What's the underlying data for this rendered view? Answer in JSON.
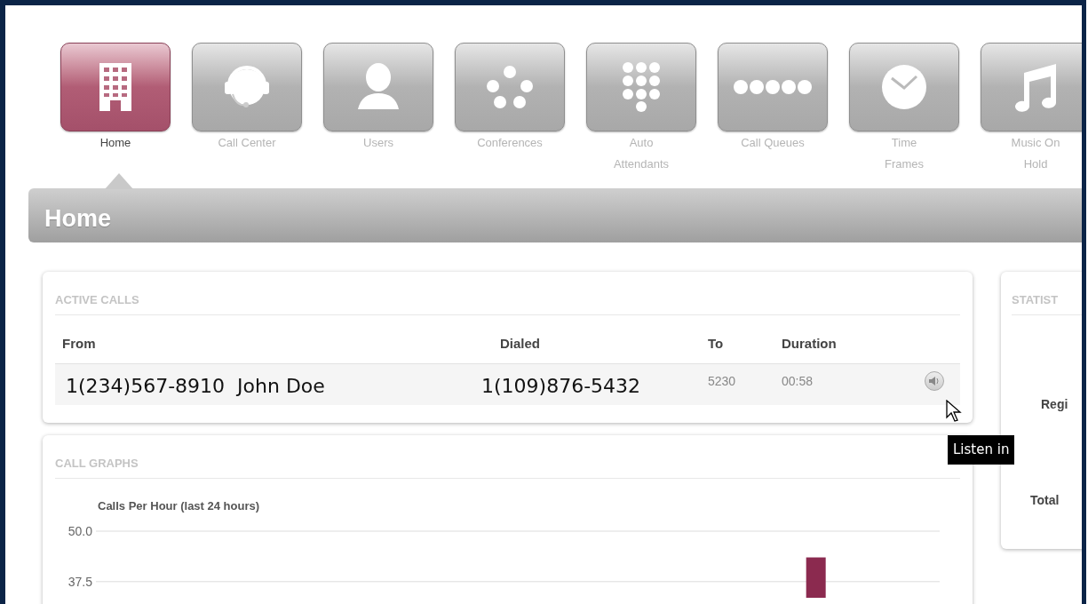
{
  "nav": [
    {
      "label": "Home",
      "selected": true
    },
    {
      "label": "Call Center",
      "selected": false
    },
    {
      "label": "Users",
      "selected": false
    },
    {
      "label": "Conferences",
      "selected": false
    },
    {
      "label": "Auto\nAttendants",
      "selected": false
    },
    {
      "label": "Call Queues",
      "selected": false
    },
    {
      "label": "Time\nFrames",
      "selected": false
    },
    {
      "label": "Music On\nHold",
      "selected": false
    }
  ],
  "page_title": "Home",
  "active_calls": {
    "title": "ACTIVE CALLS",
    "columns": [
      "From",
      "Dialed",
      "To",
      "Duration"
    ],
    "rows": [
      {
        "from": "1(234)567-8910  John Doe",
        "dialed": "1(109)876-5432",
        "to": "5230",
        "duration": "00:58"
      }
    ],
    "tooltip": "Listen in"
  },
  "call_graphs": {
    "title": "CALL GRAPHS",
    "chart_data": {
      "type": "bar",
      "title": "Calls Per Hour (last 24 hours)",
      "values": [
        null,
        null,
        null,
        null,
        null,
        null,
        null,
        null,
        null,
        null,
        null,
        null,
        null,
        null,
        null,
        null,
        null,
        null,
        null,
        null,
        43.5,
        null,
        null,
        null
      ],
      "ylim": [
        33.5,
        50
      ],
      "yticks": [
        {
          "value": 50,
          "label": "50.0"
        },
        {
          "value": 37.5,
          "label": "37.5"
        }
      ]
    }
  },
  "statistics": {
    "title": "STATIST",
    "labels": [
      "Regi",
      "Total"
    ]
  }
}
